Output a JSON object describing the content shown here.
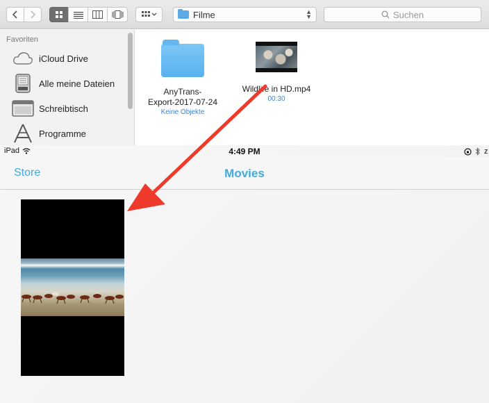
{
  "toolbar": {
    "back_icon": "chevron-left-icon",
    "forward_icon": "chevron-right-icon",
    "view_modes": [
      "icon-view-icon",
      "list-view-icon",
      "column-view-icon",
      "cover-flow-icon"
    ],
    "arrange_icon": "arrange-grid-icon",
    "path_label": "Filme",
    "search_placeholder": "Suchen"
  },
  "sidebar": {
    "heading": "Favoriten",
    "items": [
      {
        "label": "iCloud Drive",
        "icon": "cloud-icon"
      },
      {
        "label": "Alle meine Dateien",
        "icon": "all-files-icon"
      },
      {
        "label": "Schreibtisch",
        "icon": "desktop-icon"
      },
      {
        "label": "Programme",
        "icon": "applications-icon"
      }
    ]
  },
  "files": [
    {
      "name_line1": "AnyTrans-",
      "name_line2": "Export-2017-07-24",
      "sub": "Keine Objekte",
      "type": "folder"
    },
    {
      "name_line1": "Wildlife in HD.mp4",
      "sub": "00:30",
      "type": "video"
    }
  ],
  "ipad": {
    "status_left": "iPad",
    "time": "4:49 PM",
    "nav_back": "Store",
    "nav_title": "Movies"
  },
  "colors": {
    "accent": "#45a9d8",
    "arrow": "#ee3a2a",
    "folder": "#5aa9e6"
  }
}
